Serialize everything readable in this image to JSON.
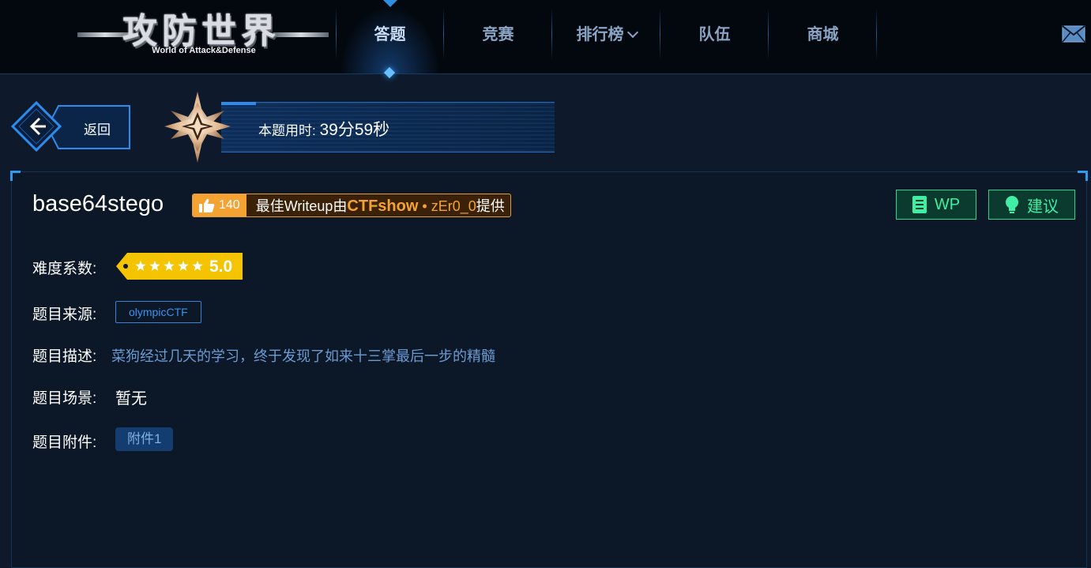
{
  "logo": {
    "title": "攻防世界",
    "subtitle": "World of Attack&Defense"
  },
  "nav": {
    "items": [
      {
        "label": "答题",
        "active": true
      },
      {
        "label": "竞赛"
      },
      {
        "label": "排行榜",
        "has_dropdown": true
      },
      {
        "label": "队伍"
      },
      {
        "label": "商城"
      }
    ],
    "mail_icon": "mail-icon"
  },
  "back": {
    "label": "返回",
    "icon": "arrow-left-icon"
  },
  "timer": {
    "label": "本题用时:",
    "value": "39分59秒",
    "icon": "star-medal-icon"
  },
  "challenge": {
    "title": "base64stego",
    "writeup": {
      "likes": "140",
      "prefix": "最佳Writeup由",
      "team": "CTFshow",
      "separator": " • ",
      "user": "zEr0_0",
      "suffix": "提供"
    },
    "buttons": {
      "wp": "WP",
      "suggest": "建议"
    },
    "difficulty": {
      "label": "难度系数:",
      "stars": 5,
      "value": "5.0"
    },
    "source": {
      "label": "题目来源:",
      "value": "olympicCTF"
    },
    "description": {
      "label": "题目描述:",
      "value": "菜狗经过几天的学习，终于发现了如来十三掌最后一步的精髓"
    },
    "scene": {
      "label": "题目场景:",
      "value": "暂无"
    },
    "attachment": {
      "label": "题目附件:",
      "value": "附件1"
    }
  },
  "colors": {
    "accent": "#2b8cf0",
    "wp_green": "#3ff0a4",
    "writeup_orange": "#f4a231",
    "rating_yellow": "#f5c400"
  }
}
